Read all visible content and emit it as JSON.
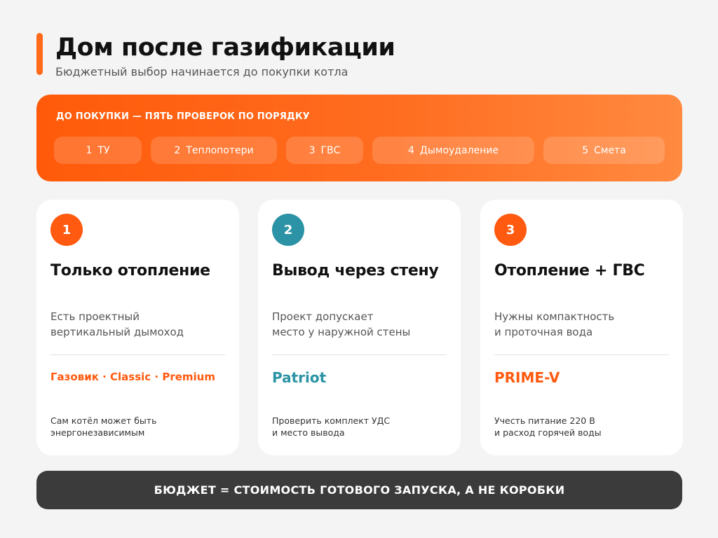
{
  "header": {
    "title": "Дом после газификации",
    "subtitle": "Бюджетный выбор начинается до покупки котла"
  },
  "checks": {
    "heading": "ДО ПОКУПКИ — ПЯТЬ ПРОВЕРОК ПО ПОРЯДКУ",
    "items": [
      {
        "num": "1",
        "label": "ТУ"
      },
      {
        "num": "2",
        "label": "Теплопотери"
      },
      {
        "num": "3",
        "label": "ГВС"
      },
      {
        "num": "4",
        "label": "Дымоудаление"
      },
      {
        "num": "5",
        "label": "Смета"
      }
    ]
  },
  "cards": [
    {
      "num": "1",
      "title": "Только отопление",
      "desc": [
        "Есть проектный",
        "вертикальный дымоход"
      ],
      "model": "Газовик · Classic · Premium",
      "note": [
        "Сам котёл может быть",
        "энергонезависимым"
      ],
      "color": "#ff5a0f"
    },
    {
      "num": "2",
      "title": "Вывод через стену",
      "desc": [
        "Проект допускает",
        "место у наружной стены"
      ],
      "model": "Patriot",
      "note": [
        "Проверить комплект УДС",
        "и место вывода"
      ],
      "color": "#2b93a5"
    },
    {
      "num": "3",
      "title": "Отопление + ГВС",
      "desc": [
        "Нужны компактность",
        "и проточная вода"
      ],
      "model": "PRIME-V",
      "note": [
        "Учесть питание 220 В",
        "и расход горячей воды"
      ],
      "color": "#ff5a0f"
    }
  ],
  "footer": {
    "text": "БЮДЖЕТ = СТОИМОСТЬ ГОТОВОГО ЗАПУСКА, А НЕ КОРОБКИ"
  }
}
